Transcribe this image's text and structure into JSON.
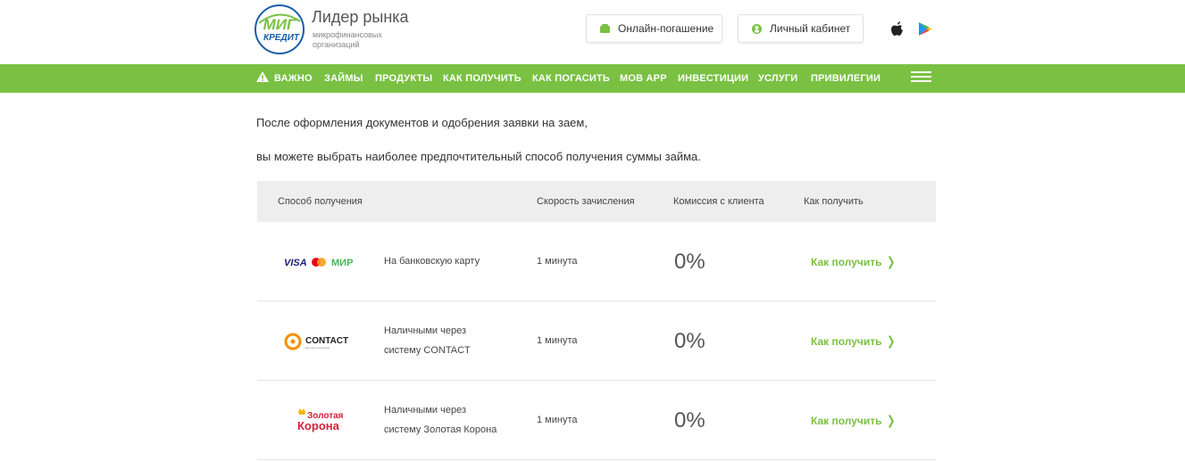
{
  "header": {
    "logo_text_top": "МИГ",
    "logo_text_bottom": "КРЕДИТ",
    "tagline_title": "Лидер рынка",
    "tagline_sub": "микрофинансовых организаций",
    "btn_pay": "Онлайн-погашение",
    "btn_cabinet": "Личный кабинет",
    "store_icons": [
      "apple-icon",
      "google-play-icon"
    ]
  },
  "nav": {
    "items": [
      "ВАЖНО",
      "ЗАЙМЫ",
      "ПРОДУКТЫ",
      "КАК ПОЛУЧИТЬ",
      "КАК ПОГАСИТЬ",
      "МОВ АРР",
      "ИНВЕСТИЦИИ",
      "УСЛУГИ",
      "ПРИВИЛЕГИИ"
    ],
    "menu_icon": "hamburger-icon"
  },
  "intro": {
    "line1": "После оформления документов и одобрения заявки на заем,",
    "line2": "вы можете выбрать наиболее предпочтительный способ получения суммы займа."
  },
  "table": {
    "headers": [
      "Способ получения",
      "Скорость зачисления",
      "Комиссия с клиента",
      "Как получить"
    ],
    "rows": [
      {
        "logo_name": "visa-mastercard-mir-logo",
        "logo_visa": "VISA",
        "logo_mir": "МИР",
        "method_line1": "На банковскую карту",
        "method_line2": "",
        "speed": "1 минута",
        "commission": "0%",
        "link": "Как получить"
      },
      {
        "logo_name": "contact-logo",
        "logo_text": "CONTACT",
        "logo_small": "Быстрые переводы",
        "method_line1": "Наличными через",
        "method_line2": "систему CONTACT",
        "speed": "1 минута",
        "commission": "0%",
        "link": "Как получить"
      },
      {
        "logo_name": "zolotaya-korona-logo",
        "logo_line1": "Золотая",
        "logo_line2": "Корона",
        "method_line1": "Наличными через",
        "method_line2": "систему Золотая Корона",
        "speed": "1 минута",
        "commission": "0%",
        "link": "Как получить"
      }
    ]
  },
  "colors": {
    "brand_green": "#7ac143",
    "logo_blue": "#1a5ea8",
    "header_bg": "#eeeeee"
  }
}
